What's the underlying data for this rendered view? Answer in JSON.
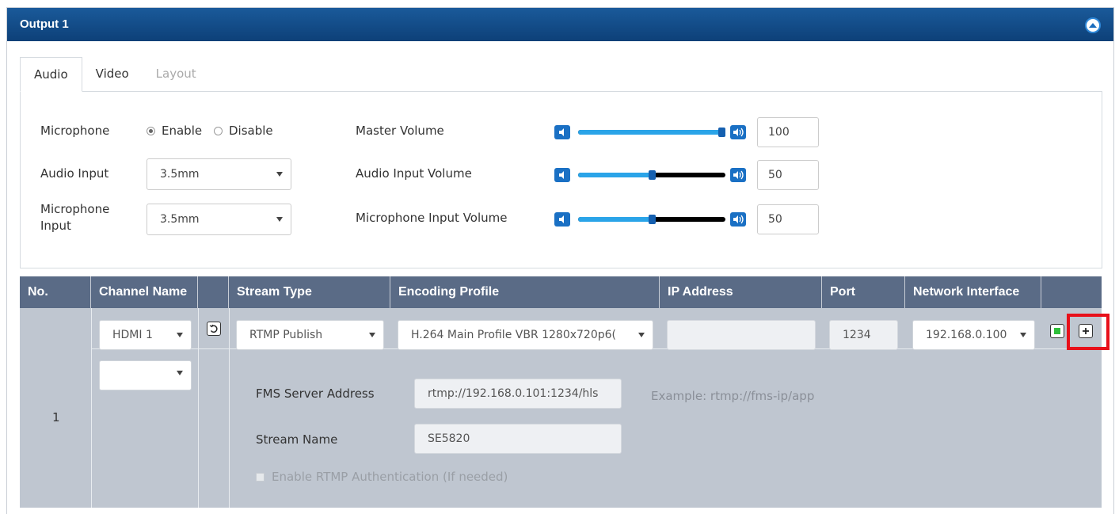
{
  "panel": {
    "title": "Output 1"
  },
  "tabs": [
    {
      "label": "Audio",
      "state": "active"
    },
    {
      "label": "Video",
      "state": "normal"
    },
    {
      "label": "Layout",
      "state": "disabled"
    }
  ],
  "audio": {
    "microphone": {
      "label": "Microphone",
      "enable_label": "Enable",
      "disable_label": "Disable",
      "selected": "Enable"
    },
    "audio_input": {
      "label": "Audio Input",
      "value": "3.5mm"
    },
    "microphone_input": {
      "label_line1": "Microphone",
      "label_line2": "Input",
      "value": "3.5mm"
    },
    "master_volume": {
      "label": "Master Volume",
      "value": "100",
      "level": 1.0
    },
    "audio_input_volume": {
      "label": "Audio Input Volume",
      "value": "50",
      "level": 0.5
    },
    "microphone_input_volume": {
      "label": "Microphone Input Volume",
      "value": "50",
      "level": 0.5
    }
  },
  "table": {
    "headers": [
      "No.",
      "Channel Name",
      "",
      "Stream Type",
      "Encoding Profile",
      "IP Address",
      "Port",
      "Network Interface",
      ""
    ],
    "row": {
      "no": "1",
      "channel_name": "HDMI 1",
      "secondary_channel": "",
      "stream_type": "RTMP Publish",
      "encoding_profile": "H.264 Main Profile VBR 1280x720p6(",
      "ip_address": "",
      "port": "1234",
      "network_interface": "192.168.0.100"
    },
    "rtmp": {
      "fms_label": "FMS Server Address",
      "fms_value": "rtmp://192.168.0.101:1234/hls",
      "fms_hint": "Example: rtmp://fms-ip/app",
      "stream_name_label": "Stream Name",
      "stream_name_value": "SE5820",
      "auth_label": "Enable RTMP Authentication (If needed)"
    }
  },
  "colors": {
    "titlebar": "#0d4078",
    "table_header": "#5a6b86",
    "table_body": "#bfc6d0",
    "slider_fill": "#2aa4e8",
    "highlight_box": "#e8101a"
  }
}
